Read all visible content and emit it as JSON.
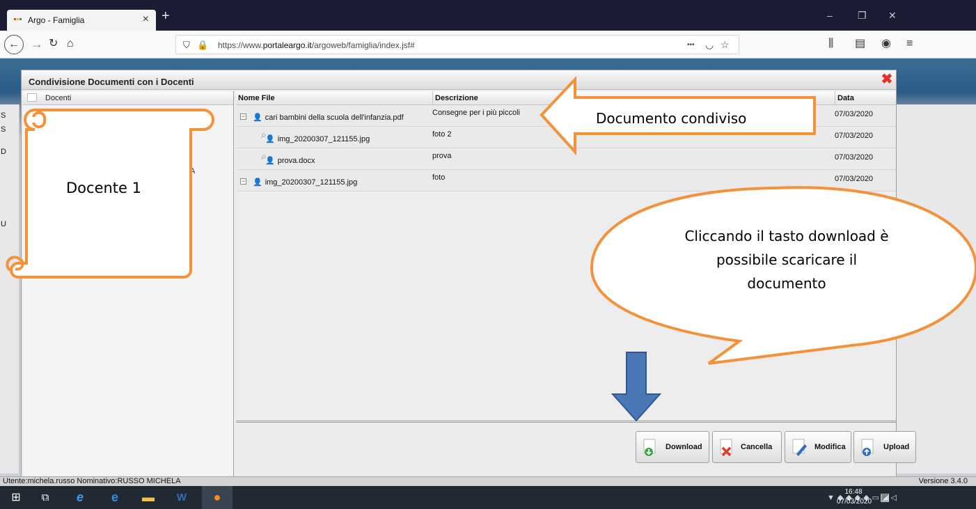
{
  "browser": {
    "tab_title": "Argo - Famiglia",
    "tab_close": "×",
    "new_tab": "+",
    "url_prefix": "https://www.",
    "url_host": "portaleargo.it",
    "url_path": "/argoweb/famiglia/index.jsf#",
    "page_actions": "•••",
    "window_controls": [
      "–",
      "❐",
      "✕"
    ]
  },
  "dialog": {
    "title": "Condivisione Documenti con i Docenti",
    "close": "✖",
    "left_header": "Docenti",
    "left_fragment": "A",
    "columns": [
      "Nome File",
      "Descrizione",
      "Data"
    ],
    "rows": [
      {
        "file": "cari bambini della scuola dell'infanzia.pdf",
        "desc": "Consegne per i più piccoli",
        "date": "07/03/2020",
        "level": 0,
        "toggle": "−"
      },
      {
        "file": "img_20200307_121155.jpg",
        "desc": "foto 2",
        "date": "07/03/2020",
        "level": 1
      },
      {
        "file": "prova.docx",
        "desc": "prova",
        "date": "07/03/2020",
        "level": 1
      },
      {
        "file": "img_20200307_121155.jpg",
        "desc": "foto",
        "date": "07/03/2020",
        "level": 0,
        "toggle": "−"
      }
    ],
    "buttons": {
      "download": "Download",
      "cancella": "Cancella",
      "modifica": "Modifica",
      "upload": "Upload"
    }
  },
  "status": {
    "left": "Utente:michela.russo Nominativo:RUSSO MICHELA",
    "right": "Versione 3.4.0"
  },
  "side_letters": [
    "S",
    "S",
    "D",
    "U"
  ],
  "taskbar": {
    "time": "16:48",
    "date": "07/03/2020"
  },
  "annotations": {
    "scroll_label": "Docente 1",
    "arrow_label": "Documento condiviso",
    "bubble_line1": "Cliccando il tasto download è",
    "bubble_line2": "possibile scaricare il",
    "bubble_line3": "documento"
  },
  "colors": {
    "annotation_orange": "#f4923a",
    "arrow_blue": "#4a78b6",
    "close_red": "#e4312b"
  }
}
